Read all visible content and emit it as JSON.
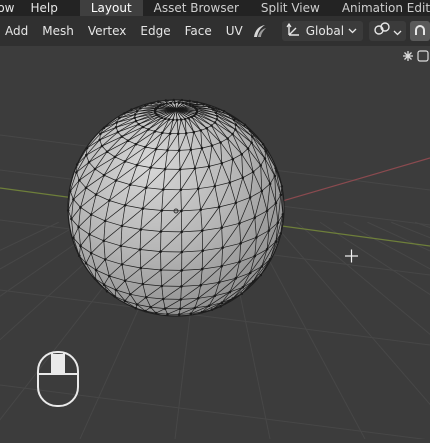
{
  "topbar": {
    "menus": [
      "low",
      "Help"
    ],
    "tabs": [
      {
        "label": "Layout",
        "active": true
      },
      {
        "label": "Asset Browser",
        "active": false
      },
      {
        "label": "Split View",
        "active": false
      },
      {
        "label": "Animation Editing",
        "active": false
      }
    ]
  },
  "header": {
    "menus": [
      "Add",
      "Mesh",
      "Vertex",
      "Edge",
      "Face",
      "UV"
    ],
    "transform_orientation": "Global",
    "icons": {
      "uv_tool": "crescent-tool-icon",
      "orientation": "transform-axes-icon",
      "pivot": "link-icon",
      "snap": "snap-magnet-icon",
      "gizmo": "gizmo-toggle-icon"
    }
  },
  "viewport": {
    "object": "uv-sphere-edit-mode",
    "cursor": "move-crosshair-cursor-icon",
    "status_icon": "mouse-icon",
    "colors": {
      "background": "#3c3c3c",
      "x_axis": "#8a4a4f",
      "y_axis": "#6e7f3a",
      "mesh_face": "#b4b4b4",
      "wire": "#1a1a1a"
    }
  }
}
